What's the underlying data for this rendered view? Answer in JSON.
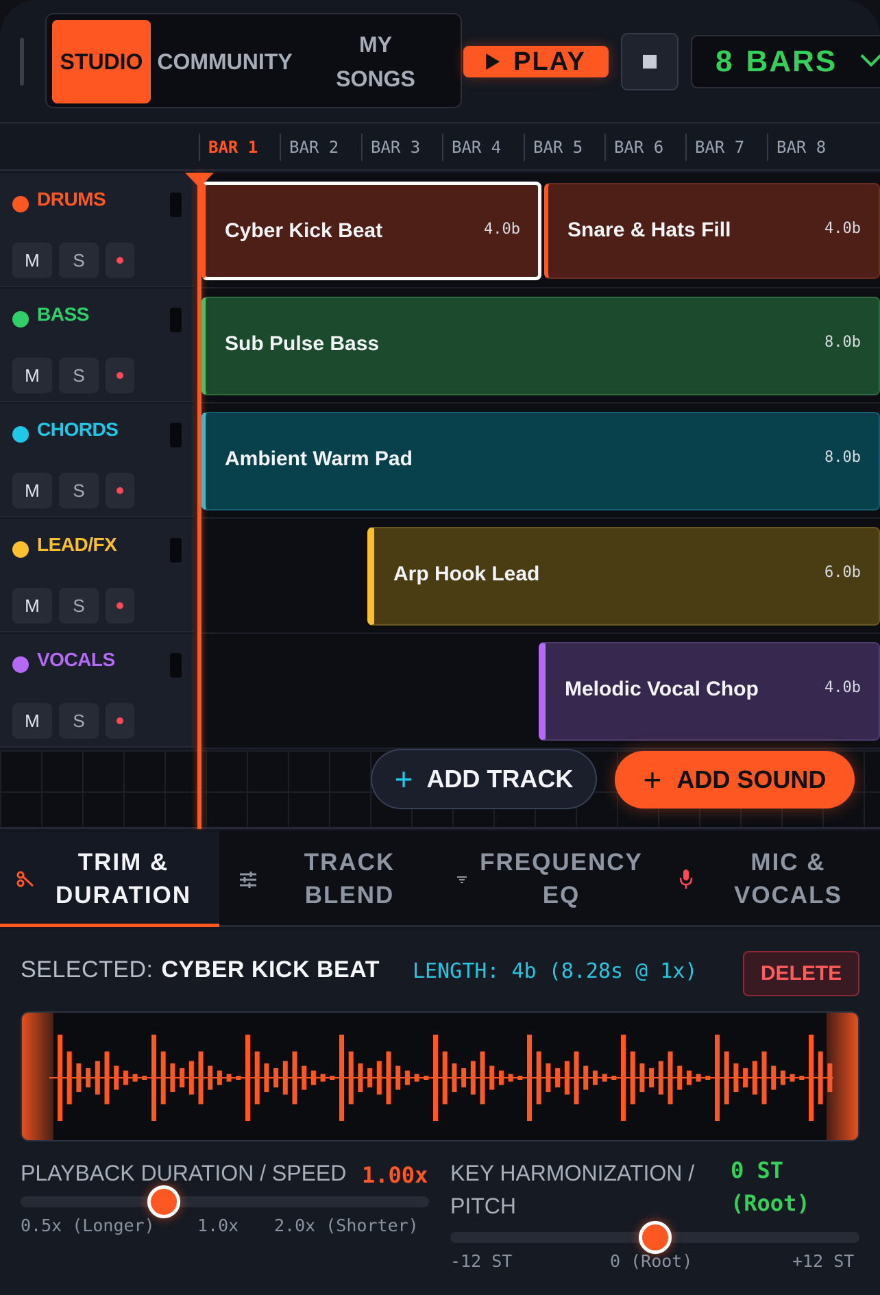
{
  "nav": {
    "tabs": [
      {
        "label": "STUDIO"
      },
      {
        "label": "COMMUNITY"
      },
      {
        "label": "MY\nSONGS"
      }
    ],
    "play_label": "PLAY",
    "bars_value": "8",
    "bars_unit": "BARS"
  },
  "ruler": {
    "bars": [
      "BAR 1",
      "BAR 2",
      "BAR 3",
      "BAR 4",
      "BAR 5",
      "BAR 6",
      "BAR 7",
      "BAR 8"
    ],
    "active_bar": "BAR 1"
  },
  "tracks": [
    {
      "name": "DRUMS",
      "color": "#ff5722",
      "mute": "M",
      "solo": "S"
    },
    {
      "name": "BASS",
      "color": "#2fd06a",
      "mute": "M",
      "solo": "S"
    },
    {
      "name": "CHORDS",
      "color": "#1ec8e6",
      "mute": "M",
      "solo": "S"
    },
    {
      "name": "LEAD/FX",
      "color": "#fbc02d",
      "mute": "M",
      "solo": "S"
    },
    {
      "name": "VOCALS",
      "color": "#b46af5",
      "mute": "M",
      "solo": "S"
    }
  ],
  "clips": [
    {
      "name": "Cyber Kick Beat",
      "length": "4.0b"
    },
    {
      "name": "Snare & Hats Fill",
      "length": "4.0b"
    },
    {
      "name": "Sub Pulse Bass",
      "length": "8.0b"
    },
    {
      "name": "Ambient Warm Pad",
      "length": "8.0b"
    },
    {
      "name": "Arp Hook Lead",
      "length": "6.0b"
    },
    {
      "name": "Melodic Vocal Chop",
      "length": "4.0b"
    }
  ],
  "actions": {
    "add_track": "ADD TRACK",
    "add_sound": "ADD SOUND"
  },
  "editor_tabs": [
    {
      "label": "TRIM &\nDURATION",
      "icon": "scissors-icon"
    },
    {
      "label": "TRACK\nBLEND",
      "icon": "sliders-icon"
    },
    {
      "label": "FREQUENCY\nEQ",
      "icon": "filter-icon"
    },
    {
      "label": "MIC &\nVOCALS",
      "icon": "mic-icon"
    }
  ],
  "editor": {
    "selected_label": "SELECTED:",
    "selected_name": "CYBER KICK BEAT",
    "length_text": "LENGTH: 4b (8.28s @ 1x)",
    "delete_label": "DELETE",
    "speed": {
      "label": "PLAYBACK DURATION / SPEED",
      "value": "1.00x",
      "level": 0.35,
      "ticks": [
        "0.5x (Longer)",
        "1.0x",
        "2.0x (Shorter)"
      ]
    },
    "pitch": {
      "label": "KEY HARMONIZATION / PITCH",
      "value": "0 ST (Root)",
      "level": 0.5,
      "ticks": [
        "-12 ST",
        "0 (Root)",
        "+12 ST"
      ]
    }
  },
  "colors": {
    "accent": "#ff5722",
    "bars_green": "#34d058",
    "length_cyan": "#27c6e0"
  }
}
